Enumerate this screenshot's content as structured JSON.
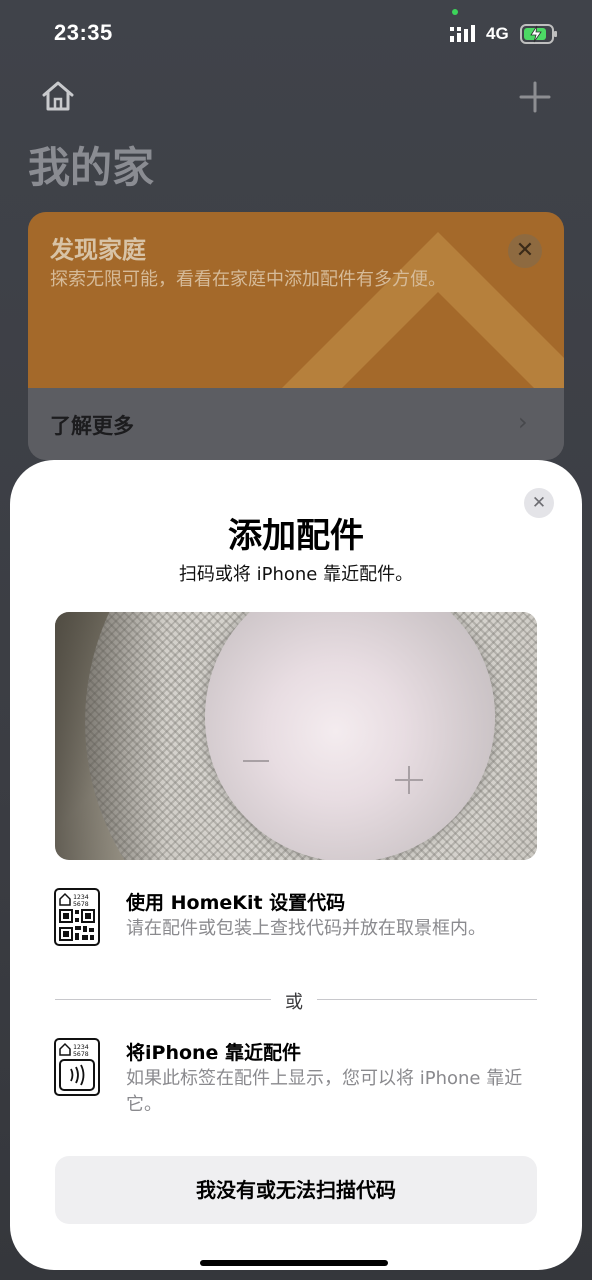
{
  "status_bar": {
    "time": "23:35",
    "network": "4G",
    "icons": [
      "signal-icon",
      "battery-charging-icon"
    ]
  },
  "background": {
    "header": {
      "title": "我的家",
      "icons": [
        "home-icon",
        "add-icon"
      ]
    },
    "discover_card": {
      "title": "发现家庭",
      "text": "探索无限可能，看看在家庭中添加配件有多方便。",
      "link_label": "了解更多",
      "accent_color": "#a4692a"
    }
  },
  "sheet": {
    "title": "添加配件",
    "subtitle": "扫码或将 iPhone 靠近配件。",
    "close_symbol": "✕",
    "options": [
      {
        "icon": "homekit-qr-code-icon",
        "icon_code": "1234 5678",
        "title": "使用 HomeKit 设置代码",
        "description": "请在配件或包装上查找代码并放在取景框内。"
      },
      {
        "icon": "nfc-tag-icon",
        "icon_code": "1234 5678",
        "title": "将iPhone 靠近配件",
        "description": "如果此标签在配件上显示，您可以将 iPhone 靠近它。"
      }
    ],
    "divider_text": "或",
    "button_label": "我没有或无法扫描代码"
  }
}
